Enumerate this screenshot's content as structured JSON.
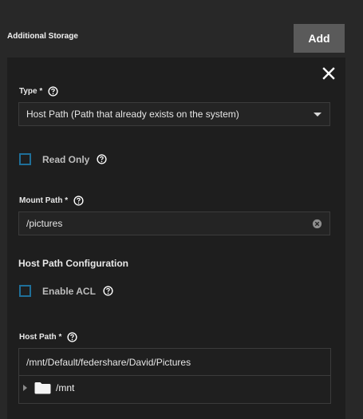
{
  "section": {
    "title": "Additional Storage",
    "add_label": "Add"
  },
  "form": {
    "type": {
      "label": "Type *",
      "value": "Host Path (Path that already exists on the system)"
    },
    "read_only": {
      "label": "Read Only",
      "checked": false
    },
    "mount_path": {
      "label": "Mount Path *",
      "value": "/pictures"
    },
    "host_path_config": {
      "title": "Host Path Configuration"
    },
    "enable_acl": {
      "label": "Enable ACL",
      "checked": false
    },
    "host_path": {
      "label": "Host Path *",
      "value": "/mnt/Default/federshare/David/Pictures",
      "tree": [
        {
          "name": "/mnt",
          "expanded": false
        }
      ]
    }
  },
  "icons": {
    "close": "close-icon",
    "help": "help-circle-icon",
    "dropdown": "caret-down-icon",
    "clear": "clear-circle-icon",
    "folder": "folder-icon",
    "expand": "tree-expand-icon"
  },
  "colors": {
    "background": "#282828",
    "card": "#1e1e1e",
    "button": "#5a5a5a",
    "checkbox_border": "#1f6f99",
    "field_border": "#3b3b3b"
  }
}
